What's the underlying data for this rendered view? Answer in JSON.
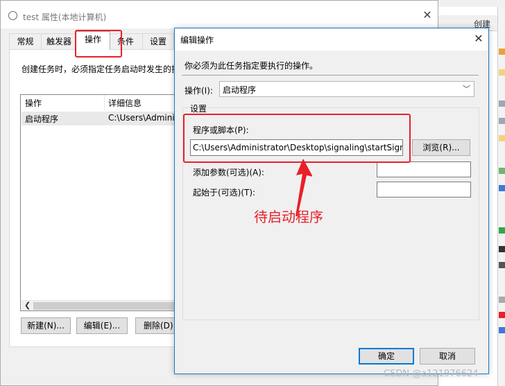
{
  "background_window": {
    "header_text": "创建"
  },
  "prop_window": {
    "title": "test 属性(本地计算机)",
    "tabs": [
      "常规",
      "触发器",
      "操作",
      "条件",
      "设置"
    ],
    "active_tab": "操作",
    "description": "创建任务时，必须指定任务启动时发生的操",
    "columns": [
      "操作",
      "详细信息"
    ],
    "rows": [
      {
        "action": "启动程序",
        "detail": "C:\\Users\\Adminis"
      }
    ],
    "buttons": {
      "new": "新建(N)...",
      "edit": "编辑(E)...",
      "delete": "删除(D)"
    }
  },
  "edit_dialog": {
    "title": "编辑操作",
    "instruction": "你必须为此任务指定要执行的操作。",
    "action_label": "操作(I):",
    "action_value": "启动程序",
    "settings_group": "设置",
    "program_label": "程序或脚本(P):",
    "program_value": "C:\\Users\\Administrator\\Desktop\\signaling\\startSign",
    "browse_button": "浏览(R)...",
    "args_label": "添加参数(可选)(A):",
    "start_label": "起始于(可选)(T):",
    "ok_button": "确定",
    "cancel_button": "取消"
  },
  "annotation": {
    "text": "待启动程序",
    "color": "#e8202a"
  },
  "watermark": "CSDN @a121976624",
  "colors": {
    "accent_border": "#1979ca",
    "button_face": "#e1e1e1",
    "window_bg": "#f0f0f0"
  }
}
